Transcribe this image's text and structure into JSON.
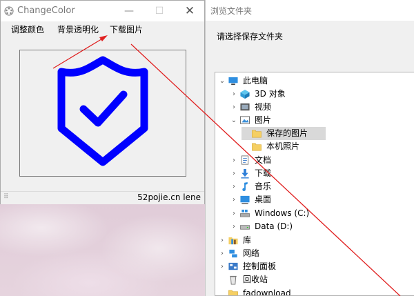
{
  "app_window": {
    "title": "ChangeColor",
    "controls": {
      "minimize": "—",
      "maximize": "☐",
      "close": "✕"
    },
    "menu": [
      "调整颜色",
      "背景透明化",
      "下载图片"
    ],
    "status_text": "52pojie.cn lene",
    "status_grip": "⠿"
  },
  "browse_dialog": {
    "title": "浏览文件夹",
    "prompt": "请选择保存文件夹",
    "tree": [
      {
        "label": "此电脑",
        "icon": "pc-icon",
        "arrow": "⌄"
      },
      {
        "label": "3D 对象",
        "icon": "3d-objects-icon",
        "arrow": "›"
      },
      {
        "label": "视频",
        "icon": "video-icon",
        "arrow": "›"
      },
      {
        "label": "图片",
        "icon": "pictures-icon",
        "arrow": "⌄"
      },
      {
        "label": "保存的图片",
        "icon": "folder-icon",
        "arrow": "",
        "selected": true
      },
      {
        "label": "本机照片",
        "icon": "folder-icon",
        "arrow": ""
      },
      {
        "label": "文档",
        "icon": "documents-icon",
        "arrow": "›"
      },
      {
        "label": "下载",
        "icon": "download-icon",
        "arrow": "›"
      },
      {
        "label": "音乐",
        "icon": "music-icon",
        "arrow": "›"
      },
      {
        "label": "桌面",
        "icon": "desktop-icon",
        "arrow": "›"
      },
      {
        "label": "Windows (C:)",
        "icon": "windows-drive-icon",
        "arrow": "›"
      },
      {
        "label": "Data (D:)",
        "icon": "drive-icon",
        "arrow": "›"
      },
      {
        "label": "库",
        "icon": "library-icon",
        "arrow": "›"
      },
      {
        "label": "网络",
        "icon": "network-icon",
        "arrow": "›"
      },
      {
        "label": "控制面板",
        "icon": "control-panel-icon",
        "arrow": "›"
      },
      {
        "label": "回收站",
        "icon": "recycle-bin-icon",
        "arrow": ""
      },
      {
        "label": "fadownload",
        "icon": "folder-icon",
        "arrow": ""
      }
    ]
  },
  "colors": {
    "shield_icon": "#0000ff",
    "annotation": "#e02020",
    "selection": "#d9d9d9"
  }
}
